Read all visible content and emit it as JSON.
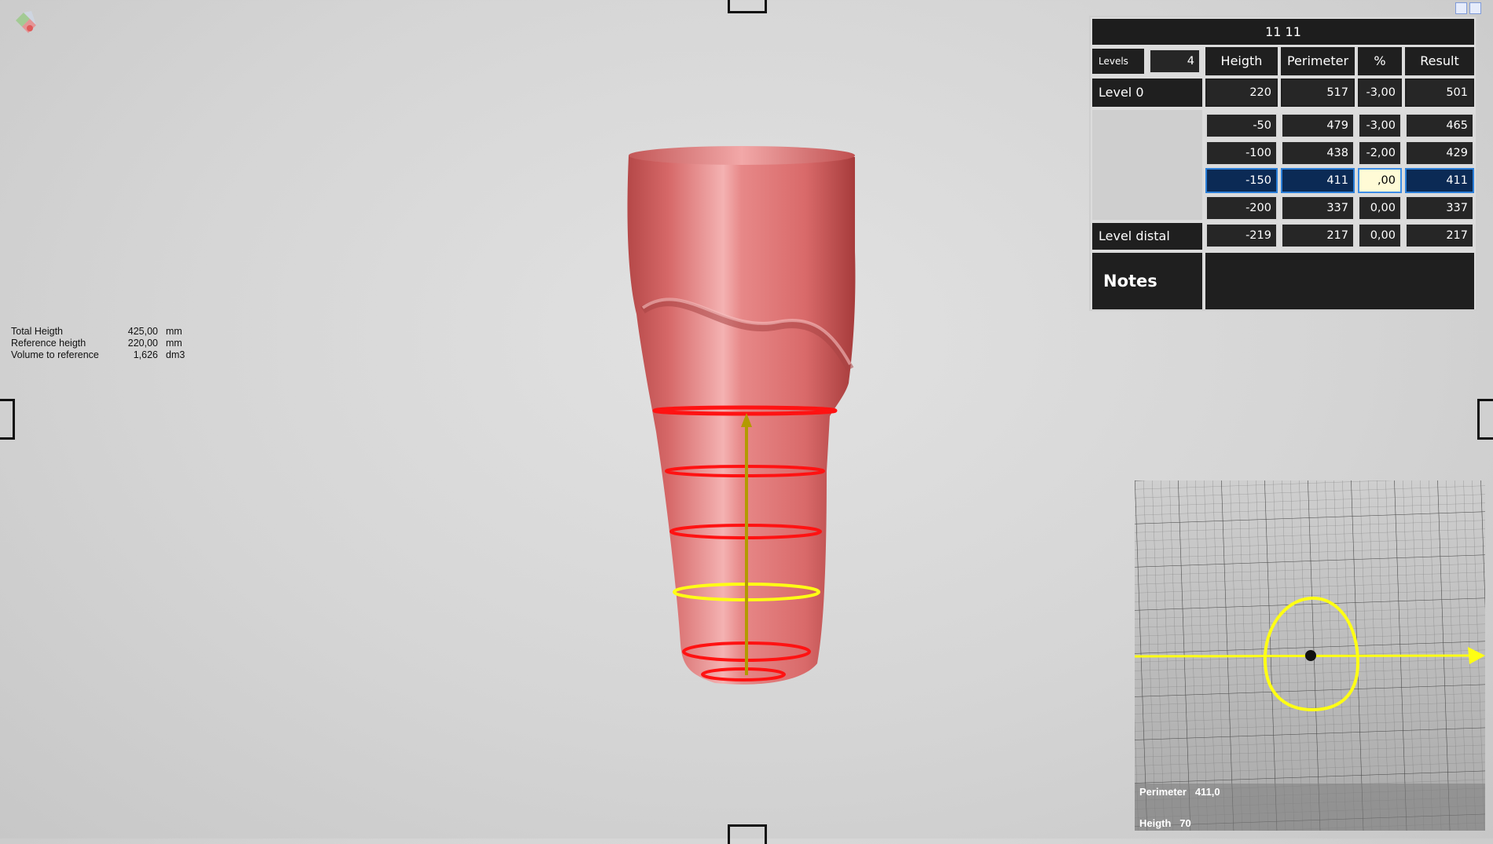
{
  "viewport": {
    "background_color": "#d8d8d8",
    "model_color": "#e07070",
    "level_ring_color": "#ff1010",
    "active_ring_color": "#ffff10",
    "axis_color": "#b8a000"
  },
  "info": {
    "rows": [
      {
        "label": "Total Heigth",
        "value": "425,00",
        "unit": "mm"
      },
      {
        "label": "Reference heigth",
        "value": "220,00",
        "unit": "mm"
      },
      {
        "label": "Volume to reference",
        "value": "1,626",
        "unit": "dm3"
      }
    ]
  },
  "table": {
    "title": "11 11",
    "levels_label": "Levels",
    "levels_value": "4",
    "headers": {
      "height": "Heigth",
      "perimeter": "Perimeter",
      "percent": "%",
      "result": "Result"
    },
    "level0": {
      "label": "Level 0",
      "height": "220",
      "perimeter": "517",
      "percent": "-3,00",
      "result": "501"
    },
    "rows": [
      {
        "height": "-50",
        "perimeter": "479",
        "percent": "-3,00",
        "result": "465"
      },
      {
        "height": "-100",
        "perimeter": "438",
        "percent": "-2,00",
        "result": "429"
      },
      {
        "height": "-150",
        "perimeter": "411",
        "percent": ",00",
        "result": "411"
      },
      {
        "height": "-200",
        "perimeter": "337",
        "percent": "0,00",
        "result": "337"
      }
    ],
    "distal": {
      "label": "Level distal",
      "height": "-219",
      "perimeter": "217",
      "percent": "0,00",
      "result": "217"
    },
    "notes_label": "Notes",
    "notes_value": ""
  },
  "section_view": {
    "perimeter_label": "Perimeter",
    "perimeter_value": "411,0",
    "height_label": "Heigth",
    "height_value": "70"
  }
}
